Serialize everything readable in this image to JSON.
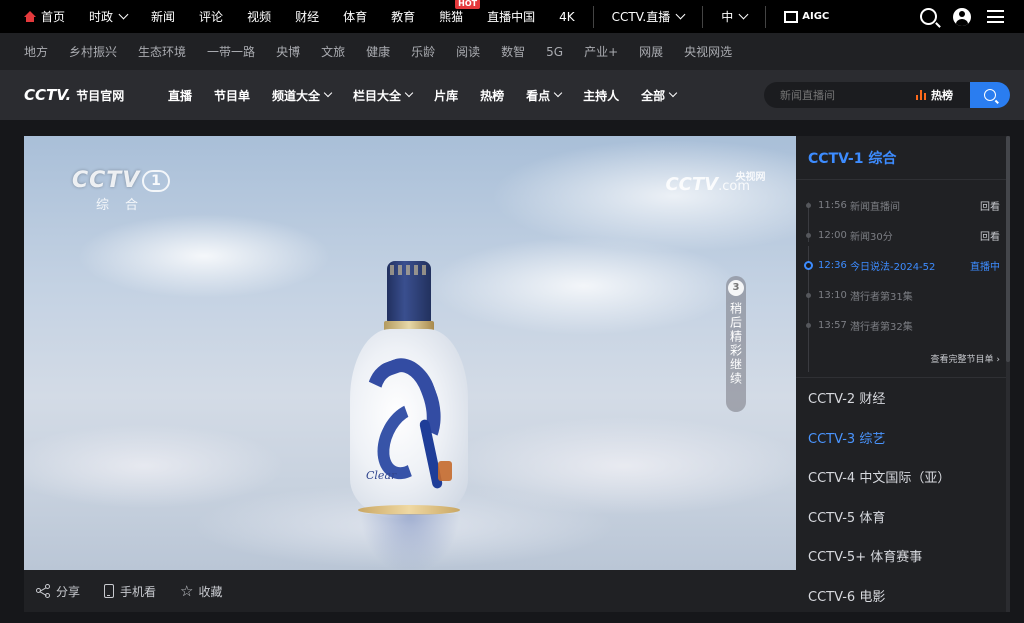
{
  "top_nav": {
    "items": [
      {
        "label": "首页"
      },
      {
        "label": "时政"
      },
      {
        "label": "新闻"
      },
      {
        "label": "评论"
      },
      {
        "label": "视频"
      },
      {
        "label": "财经"
      },
      {
        "label": "体育"
      },
      {
        "label": "教育"
      },
      {
        "label": "熊猫"
      },
      {
        "label": "直播中国"
      },
      {
        "label": "4K"
      }
    ],
    "hot_badge": "HOT",
    "live_label": "CCTV.直播",
    "lang_label": "中",
    "aigc_label": "AIGC"
  },
  "sub_nav": {
    "items": [
      "地方",
      "乡村振兴",
      "生态环境",
      "一带一路",
      "央博",
      "文旅",
      "健康",
      "乐龄",
      "阅读",
      "数智",
      "5G",
      "产业+",
      "网展",
      "央视网选"
    ]
  },
  "brand_bar": {
    "logo": "CCTV.",
    "logo_sub": "节目官网",
    "items": [
      {
        "label": "直播"
      },
      {
        "label": "节目单"
      },
      {
        "label": "频道大全"
      },
      {
        "label": "栏目大全"
      },
      {
        "label": "片库"
      },
      {
        "label": "热榜"
      },
      {
        "label": "看点"
      },
      {
        "label": "主持人"
      },
      {
        "label": "全部"
      }
    ],
    "search_placeholder": "新闻直播间",
    "hot_label": "热榜"
  },
  "player": {
    "channel_logo": "CCTV",
    "channel_num": "1",
    "channel_name": "综合",
    "watermark": "CCTV",
    "watermark_com": ".com",
    "watermark_cn": "央视网",
    "upnext_num": "3",
    "upnext_text": "稍后精彩继续",
    "bottle_script": "Clear"
  },
  "player_toolbar": {
    "share": "分享",
    "mobile": "手机看",
    "favorite": "收藏"
  },
  "panel": {
    "current_channel": "CCTV-1 综合",
    "schedule": [
      {
        "time": "11:56",
        "program": "新闻直播间",
        "action": "回看"
      },
      {
        "time": "12:00",
        "program": "新闻30分",
        "action": "回看"
      },
      {
        "time": "12:36",
        "program": "今日说法-2024-52",
        "action": "直播中"
      },
      {
        "time": "13:10",
        "program": "潜行者第31集",
        "action": ""
      },
      {
        "time": "13:57",
        "program": "潜行者第32集",
        "action": ""
      }
    ],
    "full_schedule": "查看完整节目单 ›",
    "channels": [
      "CCTV-2 财经",
      "CCTV-3 综艺",
      "CCTV-4 中文国际（亚）",
      "CCTV-5 体育",
      "CCTV-5+ 体育赛事",
      "CCTV-6 电影"
    ]
  }
}
